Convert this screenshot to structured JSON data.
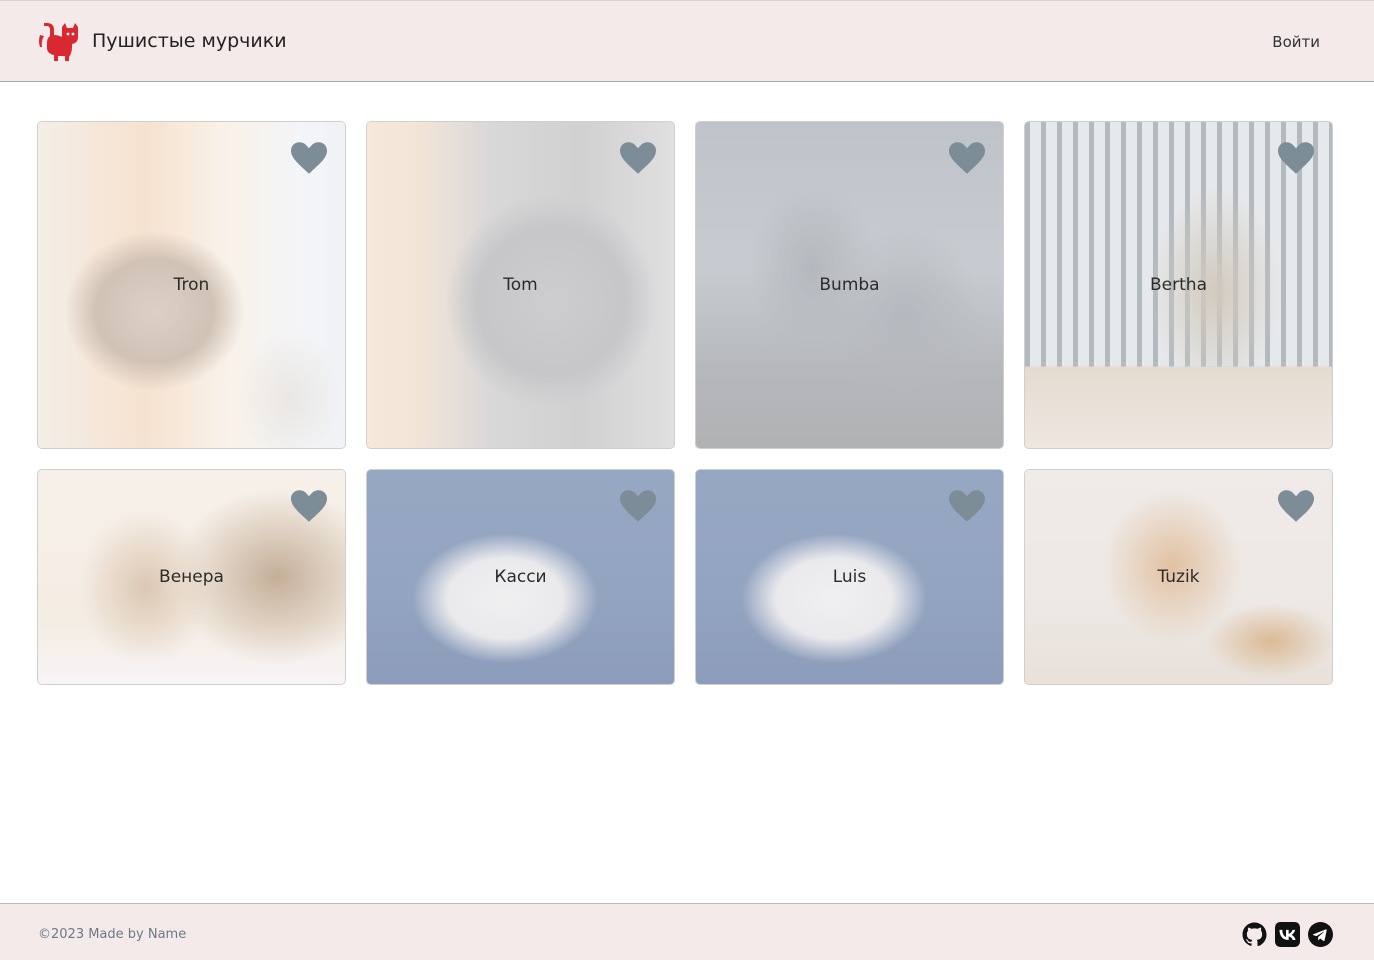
{
  "header": {
    "brand": "Пушистые мурчики",
    "login_label": "Войти",
    "logo_icon": "cat-logo-icon",
    "logo_color": "#d9282f"
  },
  "cards": [
    {
      "name": "Tron",
      "favorite_icon": "heart-icon"
    },
    {
      "name": "Tom",
      "favorite_icon": "heart-icon"
    },
    {
      "name": "Bumba",
      "favorite_icon": "heart-icon"
    },
    {
      "name": "Bertha",
      "favorite_icon": "heart-icon"
    },
    {
      "name": "Венера",
      "favorite_icon": "heart-icon"
    },
    {
      "name": "Касси",
      "favorite_icon": "heart-icon"
    },
    {
      "name": "Luis",
      "favorite_icon": "heart-icon"
    },
    {
      "name": "Tuzik",
      "favorite_icon": "heart-icon"
    }
  ],
  "footer": {
    "copyright": "©2023 Made by Name",
    "social": [
      "github-icon",
      "vk-icon",
      "telegram-icon"
    ]
  },
  "colors": {
    "header_bg": "#f3eae9",
    "heart": "#7c8d98"
  }
}
